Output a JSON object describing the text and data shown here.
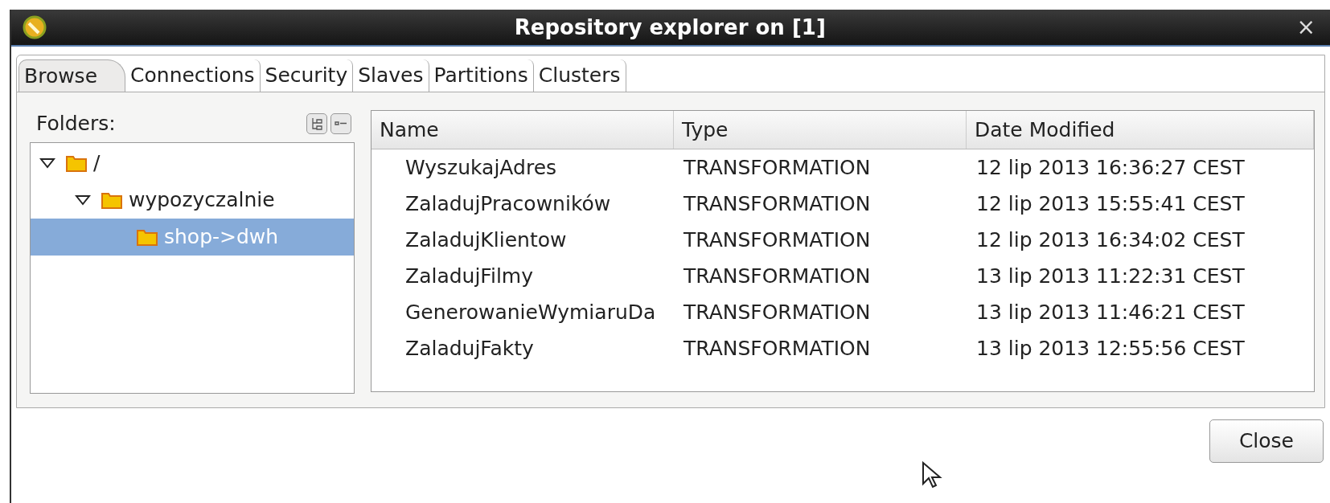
{
  "window": {
    "title": "Repository explorer on [1]",
    "close": "×"
  },
  "tabs": [
    {
      "label": "Browse",
      "selected": true
    },
    {
      "label": "Connections",
      "selected": false
    },
    {
      "label": "Security",
      "selected": false
    },
    {
      "label": "Slaves",
      "selected": false
    },
    {
      "label": "Partitions",
      "selected": false
    },
    {
      "label": "Clusters",
      "selected": false
    }
  ],
  "folders": {
    "label": "Folders:",
    "tree": [
      {
        "name": "/",
        "expanded": true,
        "selected": false,
        "children": [
          {
            "name": "wypozyczalnie",
            "expanded": true,
            "selected": false,
            "children": [
              {
                "name": "shop->dwh",
                "selected": true
              }
            ]
          }
        ]
      }
    ]
  },
  "table": {
    "columns": [
      "Name",
      "Type",
      "Date Modified"
    ],
    "rows": [
      [
        "WyszukajAdres",
        "TRANSFORMATION",
        "12 lip 2013 16:36:27 CEST"
      ],
      [
        "ZaladujPracowników",
        "TRANSFORMATION",
        "12 lip 2013 15:55:41 CEST"
      ],
      [
        "ZaladujKlientow",
        "TRANSFORMATION",
        "12 lip 2013 16:34:02 CEST"
      ],
      [
        "ZaladujFilmy",
        "TRANSFORMATION",
        "13 lip 2013 11:22:31 CEST"
      ],
      [
        "GenerowanieWymiaruDa",
        "TRANSFORMATION",
        "13 lip 2013 11:46:21 CEST"
      ],
      [
        "ZaladujFakty",
        "TRANSFORMATION",
        "13 lip 2013 12:55:56 CEST"
      ]
    ]
  },
  "buttons": [
    "Close"
  ]
}
